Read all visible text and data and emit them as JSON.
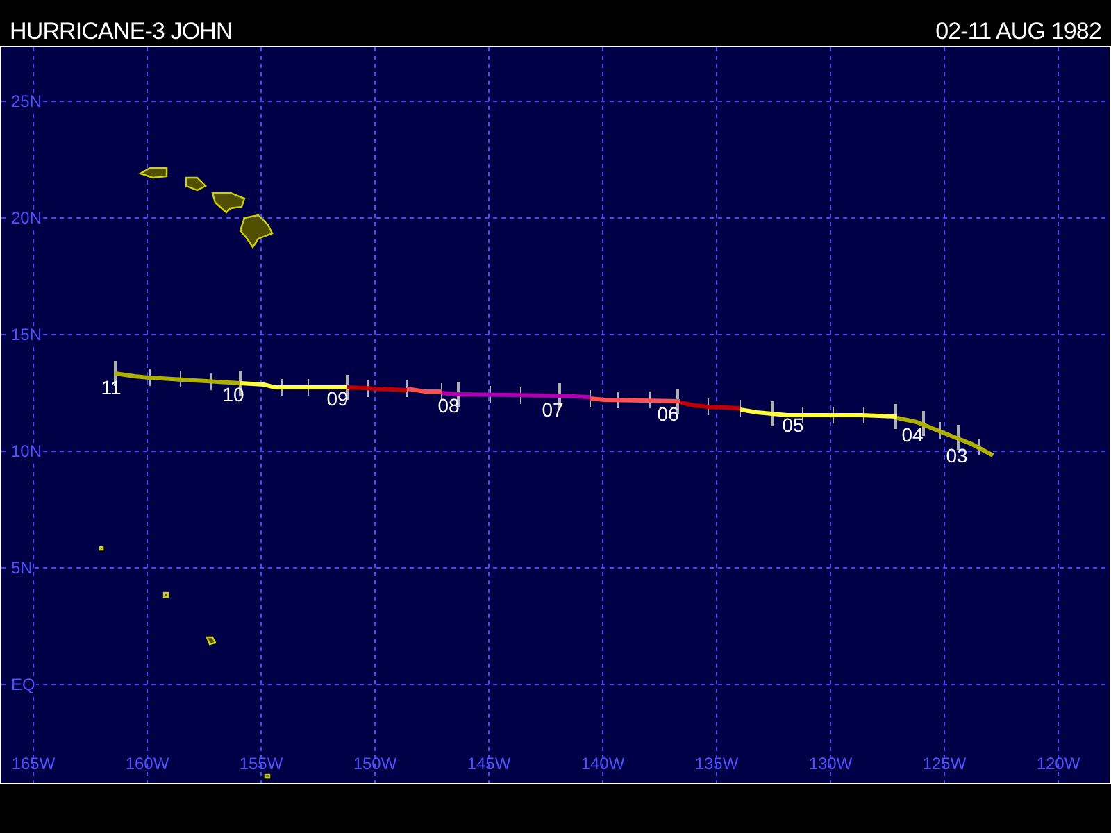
{
  "title": "HURRICANE-3 JOHN",
  "dates": "02-11 AUG 1982",
  "latitude_labels": [
    "25N",
    "20N",
    "15N",
    "10N",
    "5N",
    "EQ"
  ],
  "longitude_labels": [
    "165W",
    "160W",
    "155W",
    "150W",
    "145W",
    "140W",
    "135W",
    "130W",
    "125W",
    "120W"
  ],
  "track_segments": [
    {
      "color": "#b0b000"
    },
    {
      "color": "#ffff40"
    },
    {
      "color": "#c00000"
    },
    {
      "color": "#ff5050"
    },
    {
      "color": "#b000b0"
    },
    {
      "color": "#ff5050"
    },
    {
      "color": "#c00000"
    },
    {
      "color": "#ffff40"
    },
    {
      "color": "#b0b000"
    }
  ],
  "day_labels": [
    "11",
    "10",
    "09",
    "08",
    "07",
    "06",
    "05",
    "04",
    "03"
  ]
}
